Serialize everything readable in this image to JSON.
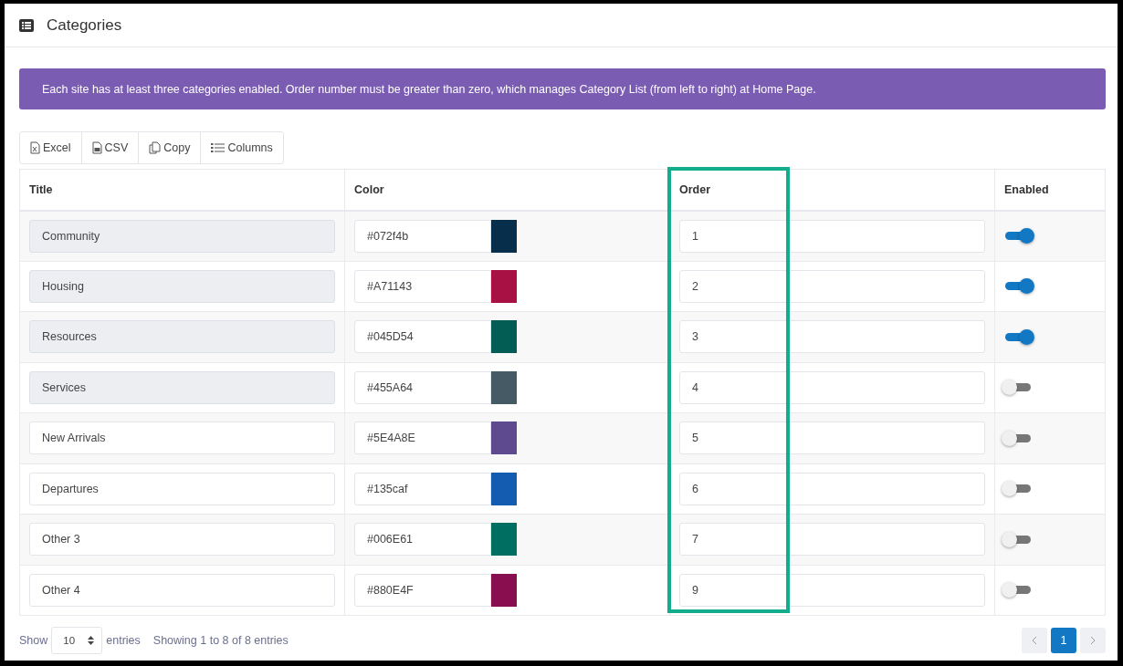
{
  "page": {
    "title": "Categories"
  },
  "notice": "Each site has at least three categories enabled. Order number must be greater than zero, which manages Category List (from left to right) at Home Page.",
  "toolbar": [
    {
      "kind": "excel",
      "label": "Excel"
    },
    {
      "kind": "csv",
      "label": "CSV"
    },
    {
      "kind": "copy",
      "label": "Copy"
    },
    {
      "kind": "columns",
      "label": "Columns"
    }
  ],
  "table": {
    "columns": [
      "Title",
      "Color",
      "Order",
      "Enabled"
    ],
    "rows": [
      {
        "title": "Community",
        "disabled": true,
        "hex": "#072f4b",
        "color": "#072f4b",
        "order": "1",
        "enabled": true
      },
      {
        "title": "Housing",
        "disabled": true,
        "hex": "#A71143",
        "color": "#a71143",
        "order": "2",
        "enabled": true
      },
      {
        "title": "Resources",
        "disabled": true,
        "hex": "#045D54",
        "color": "#045d54",
        "order": "3",
        "enabled": true
      },
      {
        "title": "Services",
        "disabled": true,
        "hex": "#455A64",
        "color": "#455a64",
        "order": "4",
        "enabled": false
      },
      {
        "title": "New Arrivals",
        "disabled": false,
        "hex": "#5E4A8E",
        "color": "#5e4a8e",
        "order": "5",
        "enabled": false
      },
      {
        "title": "Departures",
        "disabled": false,
        "hex": "#135caf",
        "color": "#135caf",
        "order": "6",
        "enabled": false
      },
      {
        "title": "Other 3",
        "disabled": false,
        "hex": "#006E61",
        "color": "#006e61",
        "order": "7",
        "enabled": false
      },
      {
        "title": "Other 4",
        "disabled": false,
        "hex": "#880E4F",
        "color": "#880e4f",
        "order": "9",
        "enabled": false
      }
    ]
  },
  "footer": {
    "show_label": "Show",
    "page_size": "10",
    "entries_label": "entries",
    "info": "Showing 1 to 8 of 8 entries"
  },
  "pagination": [
    {
      "label": "1",
      "selected": true
    }
  ]
}
